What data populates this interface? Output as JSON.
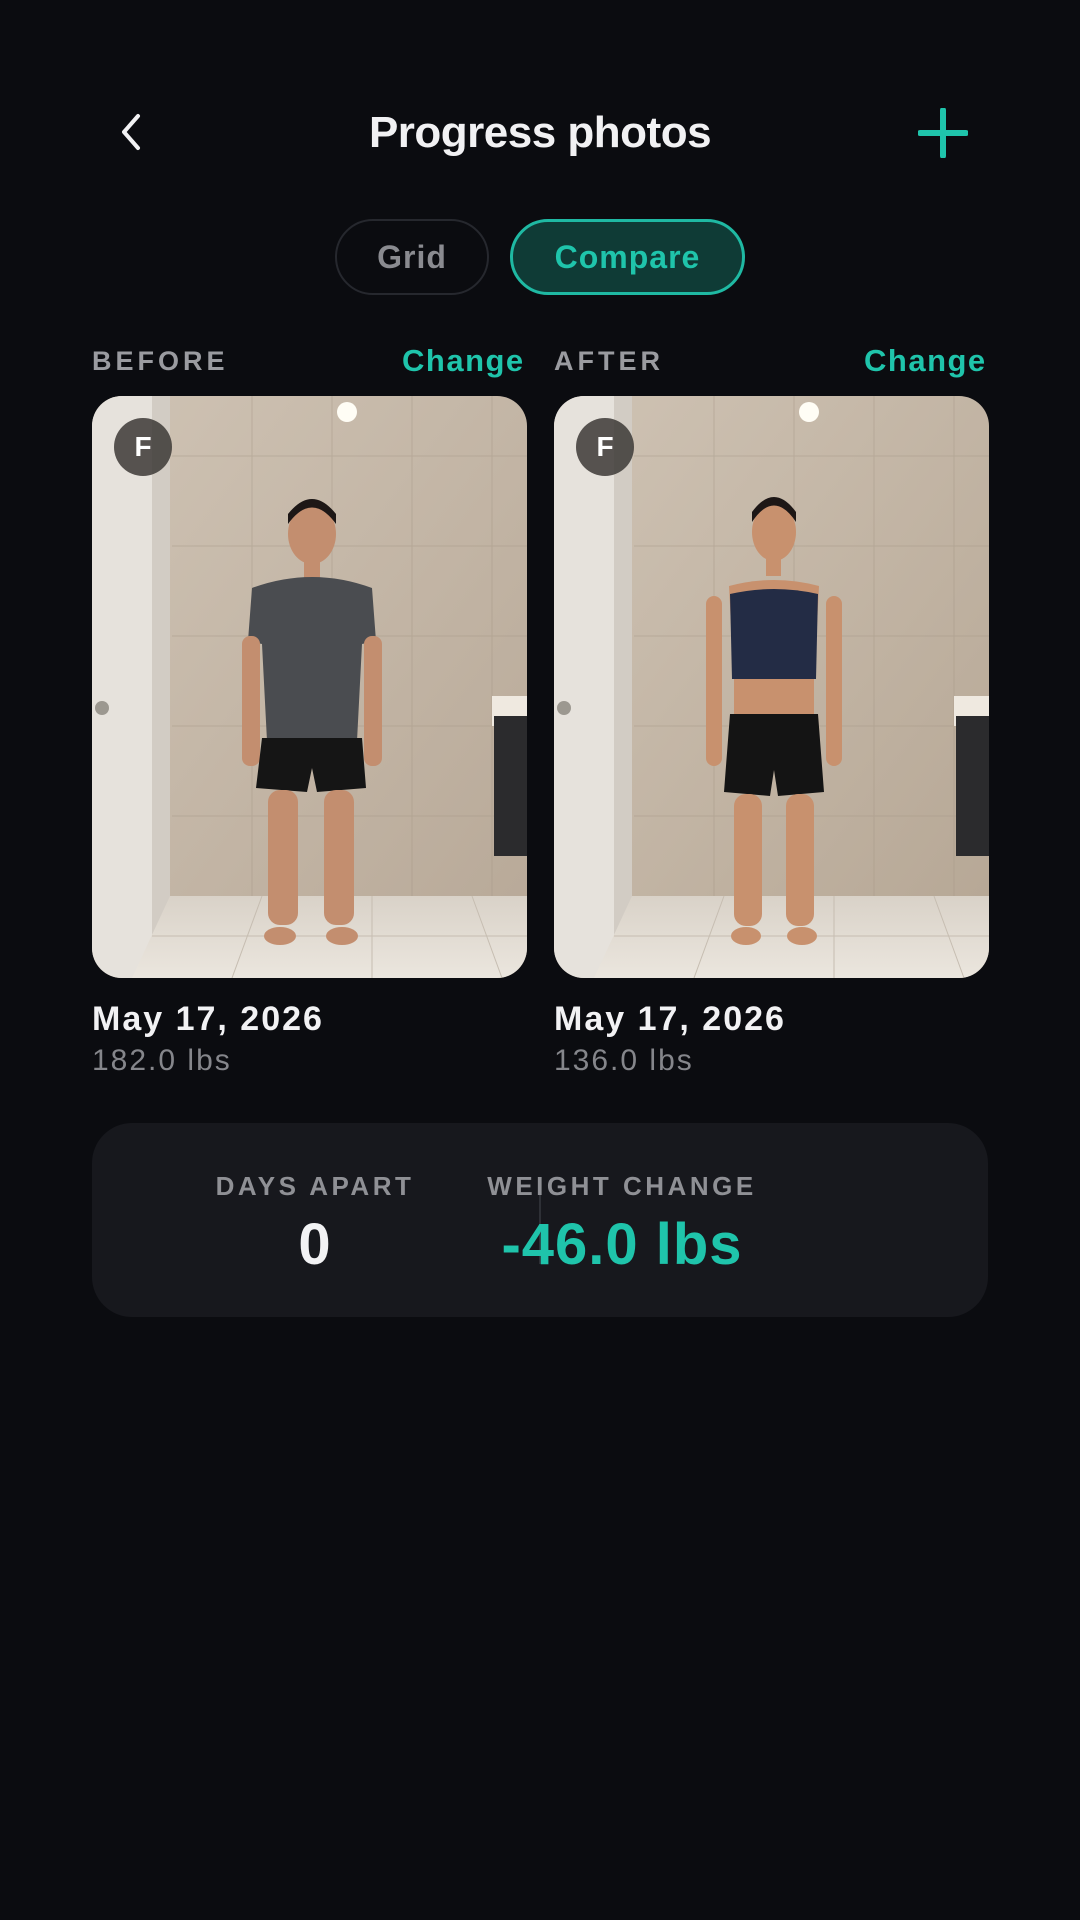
{
  "header": {
    "title": "Progress photos",
    "back_icon": "chevron-left-icon",
    "add_icon": "plus-icon"
  },
  "tabs": [
    {
      "label": "Grid",
      "active": false
    },
    {
      "label": "Compare",
      "active": true
    }
  ],
  "before": {
    "label": "BEFORE",
    "change_label": "Change",
    "badge": "F",
    "date": "May 17, 2026",
    "weight": "182.0 lbs",
    "outfit": "gray t-shirt, black shorts"
  },
  "after": {
    "label": "AFTER",
    "change_label": "Change",
    "badge": "F",
    "date": "May 17, 2026",
    "weight": "136.0 lbs",
    "outfit": "navy sports bra, black shorts"
  },
  "summary": {
    "days_apart_label": "DAYS APART",
    "days_apart_value": "0",
    "weight_change_label": "WEIGHT CHANGE",
    "weight_change_value": "-46.0 lbs"
  },
  "colors": {
    "background": "#0b0c10",
    "accent": "#1fc4ab",
    "card": "#17181d"
  }
}
